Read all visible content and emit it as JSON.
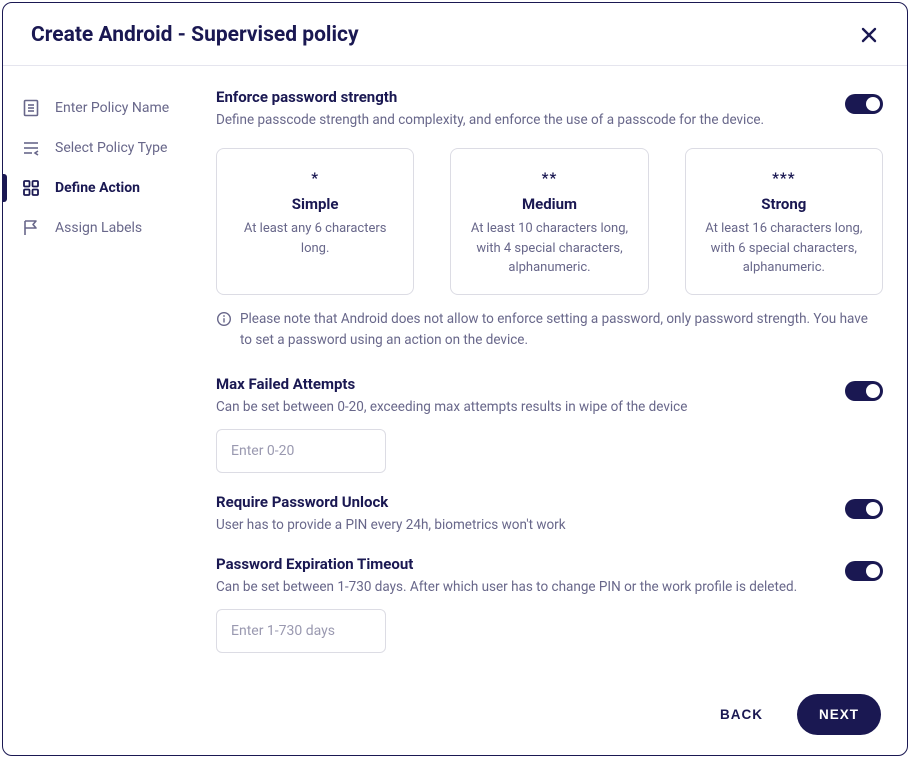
{
  "title": "Create Android - Supervised policy",
  "steps": [
    {
      "label": "Enter Policy Name",
      "active": false
    },
    {
      "label": "Select Policy Type",
      "active": false
    },
    {
      "label": "Define Action",
      "active": true
    },
    {
      "label": "Assign Labels",
      "active": false
    }
  ],
  "enforce": {
    "title": "Enforce password strength",
    "desc": "Define passcode strength and complexity, and enforce the use of a passcode for the device.",
    "toggle": true
  },
  "strength_options": [
    {
      "stars": "*",
      "name": "Simple",
      "desc": "At least any 6 characters long."
    },
    {
      "stars": "**",
      "name": "Medium",
      "desc": "At least 10 characters long, with 4 special characters, alphanumeric."
    },
    {
      "stars": "***",
      "name": "Strong",
      "desc": "At least 16 characters long, with 6 special characters, alphanumeric."
    }
  ],
  "note": "Please note that Android does not allow to enforce setting a password, only password strength. You have to set a password using an action on the device.",
  "max_failed": {
    "title": "Max Failed Attempts",
    "desc": "Can be set between 0-20, exceeding max attempts results in wipe of the device",
    "placeholder": "Enter 0-20",
    "toggle": true
  },
  "require_unlock": {
    "title": "Require Password Unlock",
    "desc": "User has to provide a PIN every 24h, biometrics won't work",
    "toggle": true
  },
  "expiration": {
    "title": "Password Expiration Timeout",
    "desc": "Can be set between 1-730 days. After which user has to change PIN or the work profile is deleted.",
    "placeholder": "Enter 1-730 days",
    "toggle": true
  },
  "footer": {
    "back": "BACK",
    "next": "NEXT"
  }
}
